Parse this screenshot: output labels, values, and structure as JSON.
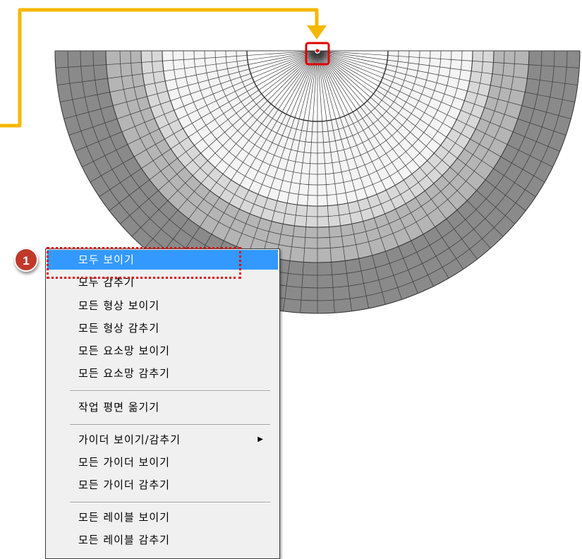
{
  "callout": {
    "step_number": "1"
  },
  "context_menu": {
    "items": [
      {
        "label": "모두 보이기",
        "active": true
      },
      {
        "label": "모두 감추기"
      },
      {
        "label": "모든 형상 보이기"
      },
      {
        "label": "모든 형상 감추기"
      },
      {
        "label": "모든 요소망 보이기"
      },
      {
        "label": "모든 요소망 감추기"
      },
      {
        "label": "작업 평면 옮기기"
      },
      {
        "label": "가이더 보이기/감추기",
        "has_submenu": true,
        "submenu_glyph": "▶"
      },
      {
        "label": "모든 가이더 보이기"
      },
      {
        "label": "모든 가이더 감추기"
      },
      {
        "label": "모든 레이블 보이기"
      },
      {
        "label": "모든 레이블 감추기"
      }
    ]
  },
  "colors": {
    "accent_arrow": "#f5b800",
    "highlight_red": "#e00000",
    "menu_selected": "#3399ff",
    "mesh_dark": "#7a7a7a",
    "mesh_mid": "#a8a8a8",
    "mesh_light": "#e6e6e6"
  }
}
